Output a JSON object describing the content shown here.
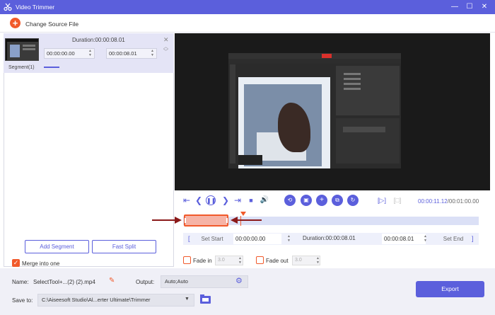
{
  "window": {
    "title": "Video Trimmer"
  },
  "toolbar": {
    "change_source": "Change Source File"
  },
  "segment": {
    "duration_label": "Duration:00:00:08.01",
    "start_time": "00:00:00.00",
    "end_time": "00:00:08.01",
    "label": "Segment(1)"
  },
  "left_buttons": {
    "add_segment": "Add Segment",
    "fast_split": "Fast Split",
    "merge": "Merge into one"
  },
  "player": {
    "current_time": "00:00:11.12",
    "total_time": "/00:01:00.00"
  },
  "set_row": {
    "set_start": "Set Start",
    "start": "00:00:00.00",
    "duration": "Duration:00:00:08.01",
    "end": "00:00:08.01",
    "set_end": "Set End"
  },
  "fade": {
    "fade_in_label": "Fade in",
    "fade_in_value": "3.0",
    "fade_out_label": "Fade out",
    "fade_out_value": "3.0"
  },
  "output": {
    "name_label": "Name:",
    "name_value": "SelectTool+...(2) (2).mp4",
    "output_label": "Output:",
    "output_value": "Auto;Auto",
    "save_label": "Save to:",
    "save_value": "C:\\Aiseesoft Studio\\Al...erter Ultimate\\Trimmer",
    "export": "Export"
  },
  "colors": {
    "accent": "#5b5fdc",
    "orange": "#f15a2b",
    "arrow": "#8b1a1a"
  }
}
